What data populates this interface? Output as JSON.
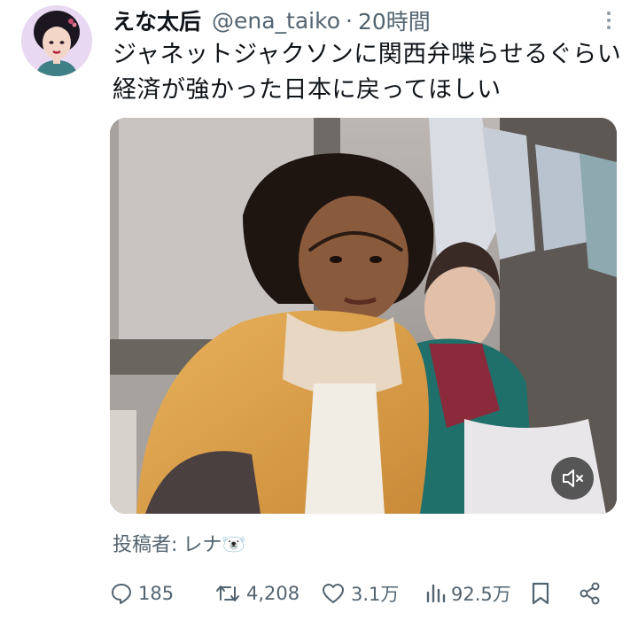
{
  "tweet": {
    "display_name": "えな太后",
    "handle": "@ena_taiko",
    "separator": "·",
    "time": "20時間",
    "text": "ジャネットジャクソンに関西弁喋らせるぐらい経済が強かった日本に戻ってほしい",
    "credit_label": "投稿者:",
    "credit_name": "レナ🐻‍❄️"
  },
  "metrics": {
    "replies": "185",
    "retweets": "4,208",
    "likes": "3.1万",
    "views": "92.5万"
  },
  "icons": {
    "more": "more-vertical-icon",
    "mute": "speaker-muted-icon",
    "reply": "reply-bubble-icon",
    "retweet": "retweet-icon",
    "like": "heart-icon",
    "views": "bar-chart-icon",
    "bookmark": "bookmark-icon",
    "share": "share-icon"
  },
  "colors": {
    "text": "#0f1419",
    "secondary": "#536471",
    "mute_bg": "#1e1e1e"
  }
}
